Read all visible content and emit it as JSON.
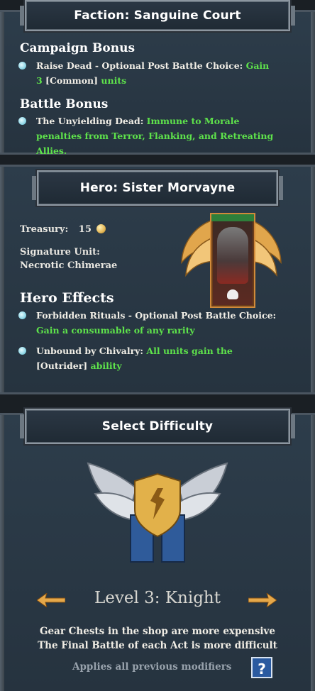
{
  "faction": {
    "title": "Faction: Sanguine Court",
    "campaign_heading": "Campaign Bonus",
    "campaign_bonus": {
      "lead": "Raise Dead - Optional Post Battle Choice: ",
      "green1": "Gain",
      "num": "3",
      "tag": " [Common] ",
      "green2": "units"
    },
    "battle_heading": "Battle Bonus",
    "battle_bonus": {
      "lead": "The Unyielding Dead: ",
      "green": "Immune to Morale penalties from Terror, Flanking, and Retreating Allies."
    }
  },
  "hero": {
    "title": "Hero: Sister Morvayne",
    "treasury_label": "Treasury:",
    "treasury_value": "15",
    "signature_label": "Signature Unit:",
    "signature_unit": "Necrotic Chimerae",
    "effects_heading": "Hero Effects",
    "effect1": {
      "lead": "Forbidden Rituals - Optional Post Battle Choice: ",
      "green": "Gain a consumable of any rarity"
    },
    "effect2": {
      "lead": "Unbound by Chivalry: ",
      "green1": "All units gain the",
      "tag": "[Outrider]",
      "green2": " ability"
    }
  },
  "difficulty": {
    "title": "Select Difficulty",
    "level": "Level 3: Knight",
    "line1": "Gear Chests in the shop are more expensive",
    "line2": "The Final Battle of each Act is more difficult",
    "note": "Applies all previous modifiers",
    "help": "?"
  },
  "icons": [
    "bullet-dot-icon",
    "gold-coin-icon",
    "skull-icon",
    "winged-shield-emblem",
    "arrow-left-icon",
    "arrow-right-icon",
    "help-icon"
  ],
  "colors": {
    "accent_green": "#5ee24b",
    "panel": "#2d3d4b",
    "bullet": "#8fd6e6",
    "gold": "#e4b655"
  }
}
